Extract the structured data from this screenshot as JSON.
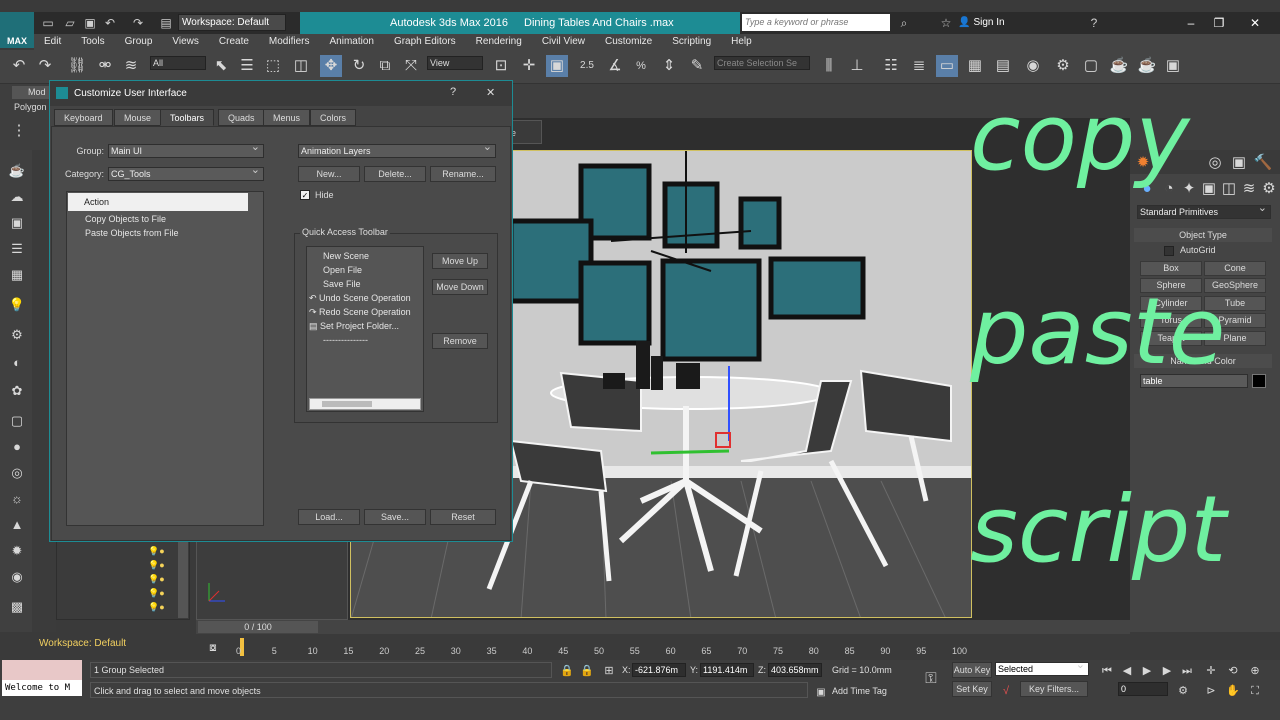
{
  "app": {
    "title": "Autodesk 3ds Max 2016",
    "file": "Dining Tables And Chairs .max",
    "logo_text": "MAX",
    "workspace_label": "Workspace: Default",
    "search_placeholder": "Type a keyword or phrase",
    "sign_in": "Sign In"
  },
  "menu": [
    "Edit",
    "Tools",
    "Group",
    "Views",
    "Create",
    "Modifiers",
    "Animation",
    "Graph Editors",
    "Rendering",
    "Civil View",
    "Customize",
    "Scripting",
    "Help"
  ],
  "toolbar": {
    "filter_value": "All",
    "refcoord_value": "View",
    "selection_set_placeholder": "Create Selection Se",
    "snap_label": "2.5"
  },
  "ribbon": {
    "tab1": "Mod",
    "tab2": "Polygon"
  },
  "dialog": {
    "title": "Customize User Interface",
    "help_btn": "?",
    "close_btn": "✕",
    "tabs": [
      "Keyboard",
      "Mouse",
      "Toolbars",
      "Quads",
      "Menus",
      "Colors"
    ],
    "group_label": "Group:",
    "group_value": "Main UI",
    "category_label": "Category:",
    "category_value": "CG_Tools",
    "toolbar_dd": "Animation Layers",
    "btn_new": "New...",
    "btn_delete": "Delete...",
    "btn_rename": "Rename...",
    "hide_label": "Hide",
    "list_header": "Action",
    "actions": [
      "Copy Objects to File",
      "Paste Objects from File"
    ],
    "qa_group_label": "Quick Access Toolbar",
    "qa_items": [
      "New Scene",
      "Open File",
      "Save File",
      "Undo Scene Operation",
      "Redo Scene Operation",
      "Set Project Folder...",
      "---------------"
    ],
    "btn_move_up": "Move Up",
    "btn_move_down": "Move Down",
    "btn_remove": "Remove",
    "btn_load": "Load...",
    "btn_save": "Save...",
    "btn_reset": "Reset"
  },
  "viewport": {
    "tab_fragment": "e"
  },
  "right_panel": {
    "category_dd": "Standard Primitives",
    "object_type_title": "Object Type",
    "autogrid": "AutoGrid",
    "buttons": [
      "Box",
      "Cone",
      "Sphere",
      "GeoSphere",
      "Cylinder",
      "Tube",
      "Torus",
      "Pyramid",
      "Teapot",
      "Plane"
    ],
    "name_color_title": "Name and Color",
    "name_value": "table"
  },
  "overlay": {
    "word1": "copy",
    "word2": "paste",
    "word3": "script"
  },
  "timeline": {
    "frame_counter": "0 / 100",
    "ticks": [
      "0",
      "5",
      "10",
      "15",
      "20",
      "25",
      "30",
      "35",
      "40",
      "45",
      "50",
      "55",
      "60",
      "65",
      "70",
      "75",
      "80",
      "85",
      "90",
      "95",
      "100"
    ]
  },
  "status": {
    "workspace_bottom": "Workspace: Default",
    "welcome": "Welcome to M",
    "selection": "1 Group Selected",
    "prompt": "Click and drag to select and move objects",
    "x_label": "X:",
    "x_value": "-621.876m",
    "y_label": "Y:",
    "y_value": "1191.414m",
    "z_label": "Z:",
    "z_value": "403.658mm",
    "grid": "Grid = 10.0mm",
    "add_time_tag": "Add Time Tag",
    "auto_key": "Auto Key",
    "set_key": "Set Key",
    "selected_dd": "Selected",
    "key_filters": "Key Filters...",
    "frame_value": "0"
  },
  "colors": {
    "accent": "#1d8c94",
    "overlay_text": "#6ff0a0"
  }
}
